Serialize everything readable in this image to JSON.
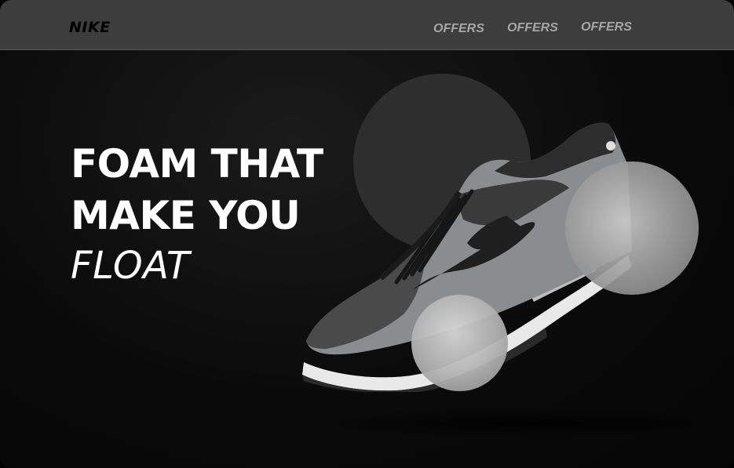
{
  "navbar": {
    "brand": "NIKE",
    "links": [
      "OFFERS",
      "OFFERS",
      "OFFERS"
    ]
  },
  "hero": {
    "line1": "FOAM THAT",
    "line2": "MAKE YOU",
    "line3": "FLOAT"
  },
  "colors": {
    "background": "#0b0b0b",
    "navbar": "#3d3d3d",
    "nav_link": "#a6a6a6",
    "headline": "#ffffff"
  },
  "icons": {
    "product_image": "sneaker-image"
  }
}
